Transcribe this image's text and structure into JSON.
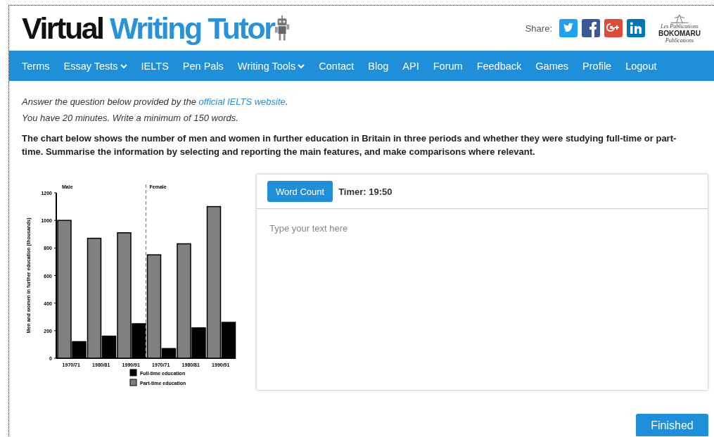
{
  "logo": {
    "first": "Virtual",
    "second": "Writing Tutor"
  },
  "share": {
    "label": "Share:"
  },
  "publisher": {
    "top": "Les Publications",
    "name": "BOKOMARU",
    "bottom": "Publications"
  },
  "nav": [
    {
      "label": "Terms",
      "dropdown": false
    },
    {
      "label": "Essay Tests",
      "dropdown": true
    },
    {
      "label": "IELTS",
      "dropdown": false
    },
    {
      "label": "Pen Pals",
      "dropdown": false
    },
    {
      "label": "Writing Tools",
      "dropdown": true
    },
    {
      "label": "Contact",
      "dropdown": false
    },
    {
      "label": "Blog",
      "dropdown": false
    },
    {
      "label": "API",
      "dropdown": false
    },
    {
      "label": "Forum",
      "dropdown": false
    },
    {
      "label": "Feedback",
      "dropdown": false
    },
    {
      "label": "Games",
      "dropdown": false
    },
    {
      "label": "Profile",
      "dropdown": false
    },
    {
      "label": "Logout",
      "dropdown": false
    }
  ],
  "intro": {
    "before": "Answer the question below provided by the ",
    "link": "official IELTS website",
    "after": "."
  },
  "time_note": "You have 20 minutes. Write a minimum of 150 words.",
  "question": "The chart below shows the number of men and women in further education in Britain in three periods and whether they were studying full-time or part-time. Summarise the information by selecting and reporting the main features, and make comparisons where relevant.",
  "chart": {
    "chart_data": {
      "type": "bar",
      "ylabel": "Men and women in further education (thousands)",
      "categories": [
        "1970/71",
        "1980/81",
        "1990/91",
        "1970/71",
        "1980/81",
        "1990/91"
      ],
      "ylim": [
        0,
        1200
      ],
      "yticks": [
        0,
        200,
        400,
        600,
        800,
        1000,
        1200
      ],
      "series": [
        {
          "name": "Part-time education",
          "color": "#808080",
          "values": [
            1000,
            870,
            910,
            750,
            830,
            1100
          ]
        },
        {
          "name": "Full-time education",
          "color": "#000000",
          "values": [
            120,
            160,
            250,
            70,
            220,
            260
          ]
        }
      ],
      "legend": true,
      "annotations": [
        "Male",
        "Female"
      ]
    }
  },
  "editor": {
    "word_count_button": "Word Count",
    "timer": "Timer: 19:50",
    "placeholder": "Type your text here"
  },
  "finish_button": "Finished"
}
